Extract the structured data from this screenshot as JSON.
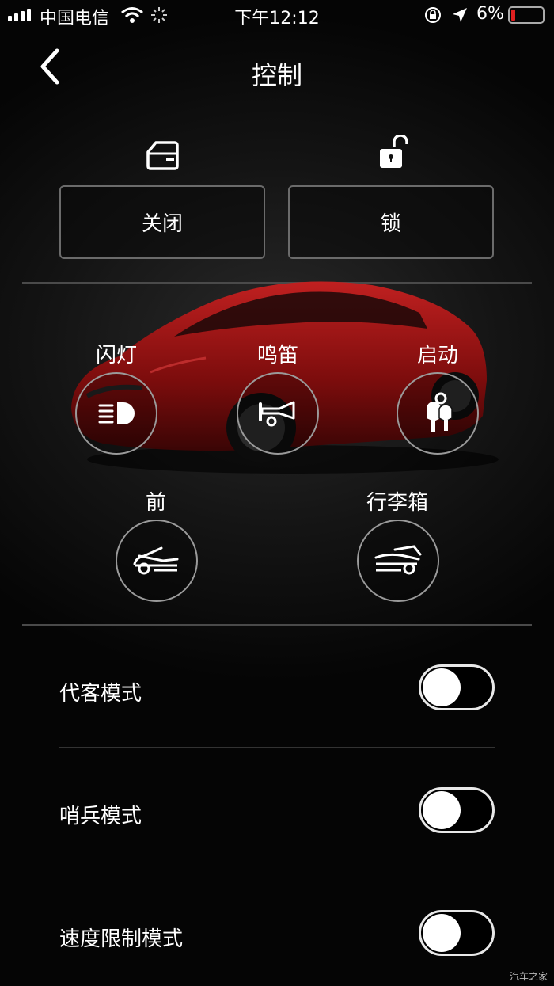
{
  "status_bar": {
    "carrier": "中国电信",
    "time": "下午12:12",
    "battery_percent": "6%",
    "battery_level": 0.06,
    "battery_color": "#e02020"
  },
  "header": {
    "title": "控制",
    "back_icon": "chevron-left-icon"
  },
  "top_actions": [
    {
      "icon": "door-icon",
      "label": "关闭"
    },
    {
      "icon": "unlocked-icon",
      "label": "锁"
    }
  ],
  "car_controls": [
    {
      "icon": "headlight-icon",
      "label": "闪灯"
    },
    {
      "icon": "horn-icon",
      "label": "鸣笛"
    },
    {
      "icon": "keys-icon",
      "label": "启动"
    }
  ],
  "trunk_controls": [
    {
      "icon": "frunk-icon",
      "label": "前"
    },
    {
      "icon": "trunk-icon",
      "label": "行李箱"
    }
  ],
  "modes": [
    {
      "label": "代客模式",
      "enabled": false
    },
    {
      "label": "哨兵模式",
      "enabled": false
    },
    {
      "label": "速度限制模式",
      "enabled": false
    }
  ],
  "watermark": "汽车之家",
  "car_color": "#8e1212"
}
